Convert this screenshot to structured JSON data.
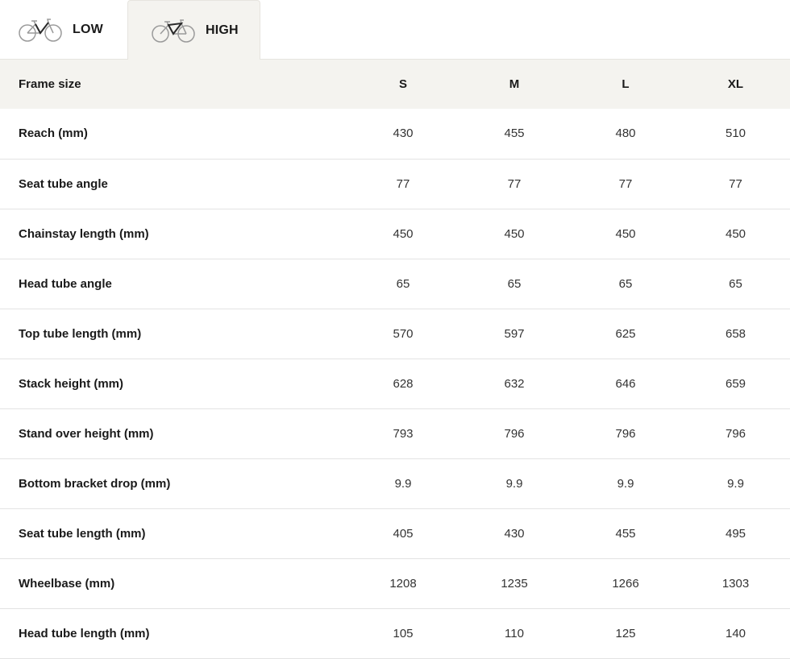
{
  "tabs": [
    {
      "label": "LOW",
      "icon": "bike-low-icon"
    },
    {
      "label": "HIGH",
      "icon": "bike-high-icon"
    }
  ],
  "table": {
    "header_label": "Frame size",
    "sizes": [
      "S",
      "M",
      "L",
      "XL"
    ],
    "rows": [
      {
        "label": "Reach (mm)",
        "values": [
          "430",
          "455",
          "480",
          "510"
        ]
      },
      {
        "label": "Seat tube angle",
        "values": [
          "77",
          "77",
          "77",
          "77"
        ]
      },
      {
        "label": "Chainstay length (mm)",
        "values": [
          "450",
          "450",
          "450",
          "450"
        ]
      },
      {
        "label": "Head tube angle",
        "values": [
          "65",
          "65",
          "65",
          "65"
        ]
      },
      {
        "label": "Top tube length (mm)",
        "values": [
          "570",
          "597",
          "625",
          "658"
        ]
      },
      {
        "label": "Stack height (mm)",
        "values": [
          "628",
          "632",
          "646",
          "659"
        ]
      },
      {
        "label": "Stand over height (mm)",
        "values": [
          "793",
          "796",
          "796",
          "796"
        ]
      },
      {
        "label": "Bottom bracket drop (mm)",
        "values": [
          "9.9",
          "9.9",
          "9.9",
          "9.9"
        ]
      },
      {
        "label": "Seat tube length (mm)",
        "values": [
          "405",
          "430",
          "455",
          "495"
        ]
      },
      {
        "label": "Wheelbase (mm)",
        "values": [
          "1208",
          "1235",
          "1266",
          "1303"
        ]
      },
      {
        "label": "Head tube length (mm)",
        "values": [
          "105",
          "110",
          "125",
          "140"
        ]
      }
    ]
  }
}
